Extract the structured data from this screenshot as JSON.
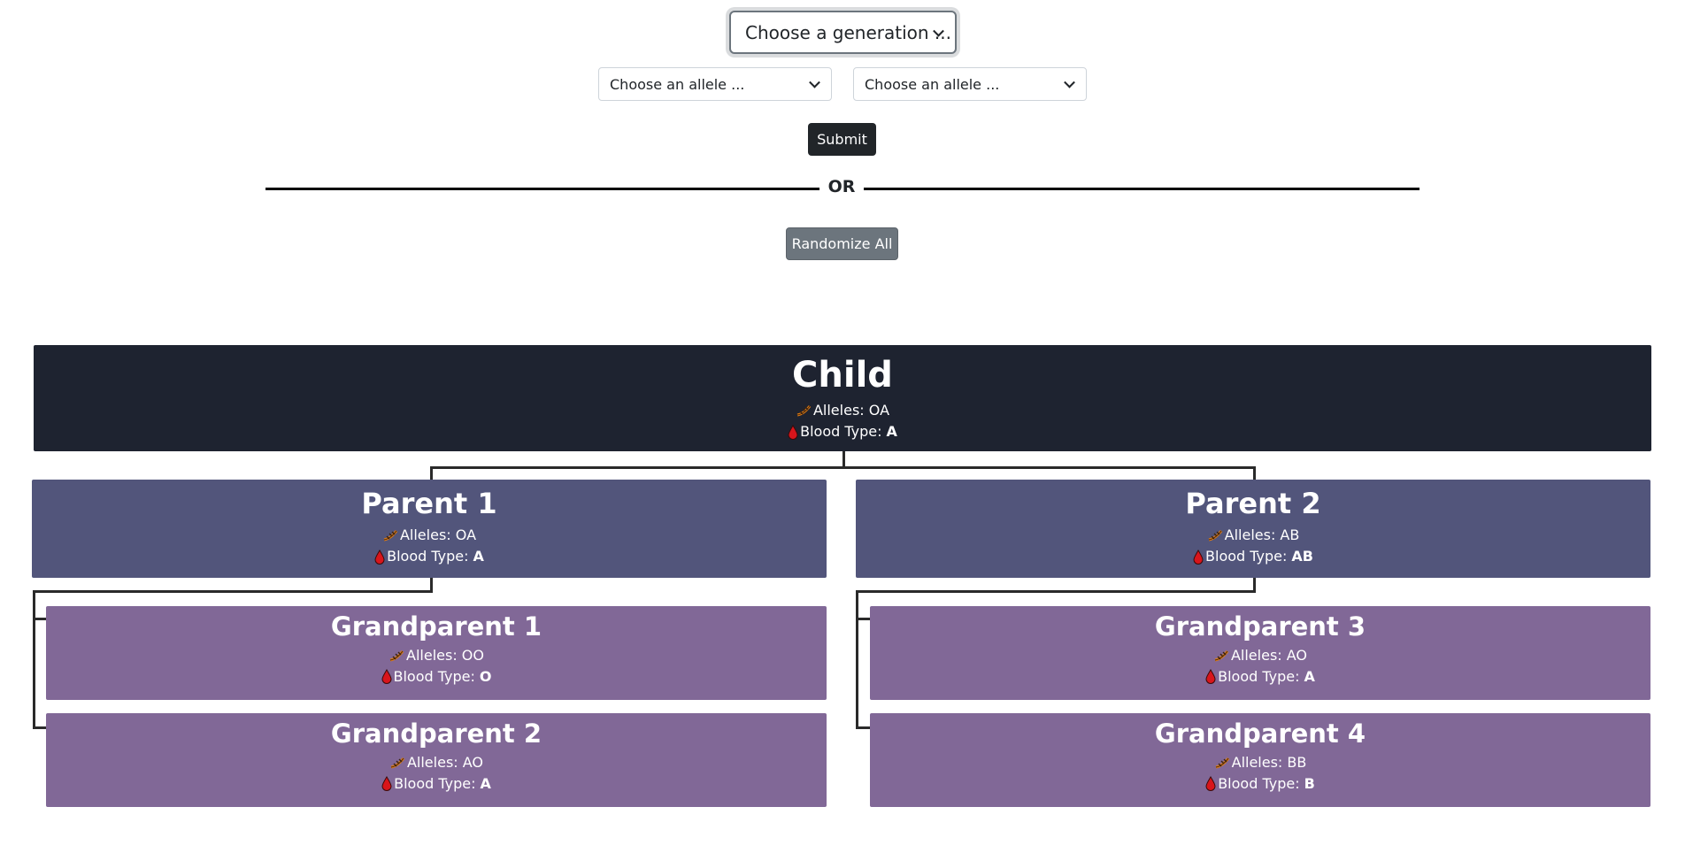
{
  "controls": {
    "generation_select": "Choose a generation ...",
    "allele_select_1": "Choose an allele ...",
    "allele_select_2": "Choose an allele ...",
    "submit_label": "Submit",
    "divider_text": "OR",
    "randomize_label": "Randomize All"
  },
  "tree": {
    "child": {
      "name": "Child",
      "alleles_label": "Alleles: OA",
      "blood_label": "Blood Type:",
      "blood_type": "A"
    },
    "parent_1": {
      "name": "Parent 1",
      "alleles_label": "Alleles: OA",
      "blood_label": "Blood Type:",
      "blood_type": "A"
    },
    "parent_2": {
      "name": "Parent 2",
      "alleles_label": "Alleles: AB",
      "blood_label": "Blood Type:",
      "blood_type": "AB"
    },
    "grandparent_1": {
      "name": "Grandparent 1",
      "alleles_label": "Alleles: OO",
      "blood_label": "Blood Type:",
      "blood_type": "O"
    },
    "grandparent_2": {
      "name": "Grandparent 2",
      "alleles_label": "Alleles: AO",
      "blood_label": "Blood Type:",
      "blood_type": "A"
    },
    "grandparent_3": {
      "name": "Grandparent 3",
      "alleles_label": "Alleles: AO",
      "blood_label": "Blood Type:",
      "blood_type": "A"
    },
    "grandparent_4": {
      "name": "Grandparent 4",
      "alleles_label": "Alleles: BB",
      "blood_label": "Blood Type:",
      "blood_type": "B"
    }
  },
  "icons": {
    "alleles": "dna-icon",
    "blood": "blood-drop-icon"
  },
  "colors": {
    "child_bg": "#1e2330",
    "parent_bg": "#52557b",
    "grandparent_bg": "#816897",
    "submit_bg": "#212529",
    "randomize_bg": "#6c757d"
  }
}
